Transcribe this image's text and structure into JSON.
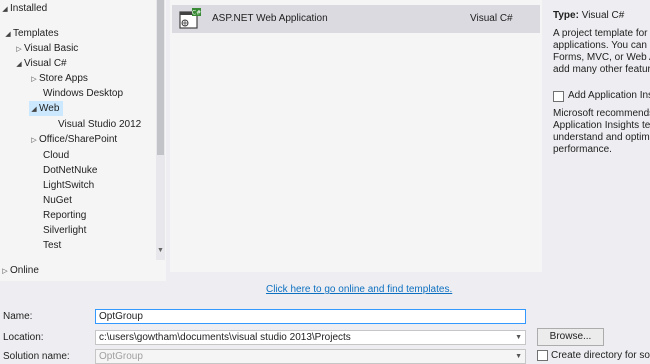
{
  "tree": {
    "installed": "Installed",
    "templates": "Templates",
    "visual_basic": "Visual Basic",
    "visual_csharp": "Visual C#",
    "store_apps": "Store Apps",
    "windows_desktop": "Windows Desktop",
    "web": "Web",
    "visual_studio_2012": "Visual Studio 2012",
    "office_sharepoint": "Office/SharePoint",
    "cloud": "Cloud",
    "dotnetnuke": "DotNetNuke",
    "lightswitch": "LightSwitch",
    "nuget": "NuGet",
    "reporting": "Reporting",
    "silverlight": "Silverlight",
    "test": "Test",
    "online": "Online"
  },
  "template_list": {
    "items": [
      {
        "name": "ASP.NET Web Application",
        "language": "Visual C#",
        "icon": "aspnet-web-app-icon"
      }
    ]
  },
  "description": {
    "type_label": "Type:",
    "type_value": "Visual C#",
    "lines": [
      "A project template for c",
      "applications. You can c",
      "Forms, MVC,  or Web A",
      "add many other feature"
    ],
    "app_insights_label": "Add Application Ins",
    "app_insights_lines": [
      "Microsoft recommends",
      "Application Insights tel",
      "understand and optimi",
      "performance."
    ]
  },
  "online_link": "Click here to go online and find templates.",
  "form": {
    "name_label": "Name:",
    "name_value": "OptGroup",
    "location_label": "Location:",
    "location_value": "c:\\users\\gowtham\\documents\\visual studio 2013\\Projects",
    "solution_label": "Solution name:",
    "solution_value": "OptGroup",
    "browse_label": "Browse...",
    "create_dir_label": "Create directory for solu"
  },
  "colors": {
    "selection": "#cce8ff",
    "link": "#0e70c0",
    "accent_border": "#3399ff"
  }
}
